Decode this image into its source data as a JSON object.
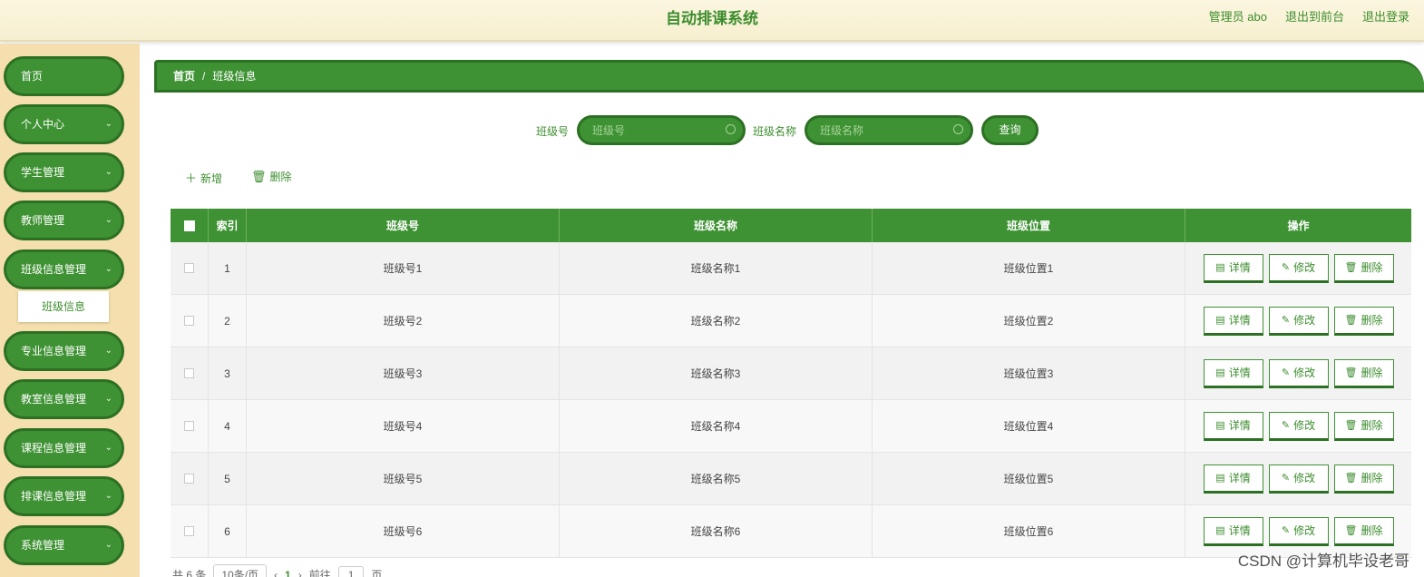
{
  "header": {
    "title": "自动排课系统",
    "user": "管理员 abo",
    "front": "退出到前台",
    "logout": "退出登录"
  },
  "sidebar": {
    "items": [
      "首页",
      "个人中心",
      "学生管理",
      "教师管理",
      "班级信息管理",
      "专业信息管理",
      "教室信息管理",
      "课程信息管理",
      "排课信息管理",
      "系统管理"
    ],
    "sub_item": "班级信息"
  },
  "breadcrumb": {
    "home": "首页",
    "sep": "/",
    "current": "班级信息"
  },
  "search": {
    "field1_label": "班级号",
    "field1_placeholder": "班级号",
    "field2_label": "班级名称",
    "field2_placeholder": "班级名称",
    "query": "查询"
  },
  "actions": {
    "add": "新增",
    "delete": "删除"
  },
  "table": {
    "headers": [
      "索引",
      "班级号",
      "班级名称",
      "班级位置",
      "操作"
    ],
    "rows": [
      [
        "1",
        "班级号1",
        "班级名称1",
        "班级位置1"
      ],
      [
        "2",
        "班级号2",
        "班级名称2",
        "班级位置2"
      ],
      [
        "3",
        "班级号3",
        "班级名称3",
        "班级位置3"
      ],
      [
        "4",
        "班级号4",
        "班级名称4",
        "班级位置4"
      ],
      [
        "5",
        "班级号5",
        "班级名称5",
        "班级位置5"
      ],
      [
        "6",
        "班级号6",
        "班级名称6",
        "班级位置6"
      ]
    ],
    "ops": {
      "detail": "详情",
      "edit": "修改",
      "delete": "删除"
    }
  },
  "pager": {
    "total": "共 6 条",
    "size": "10条/页",
    "page": "1",
    "goto": "前往",
    "goto_val": "1",
    "unit": "页"
  },
  "watermark": "CSDN @计算机毕设老哥"
}
